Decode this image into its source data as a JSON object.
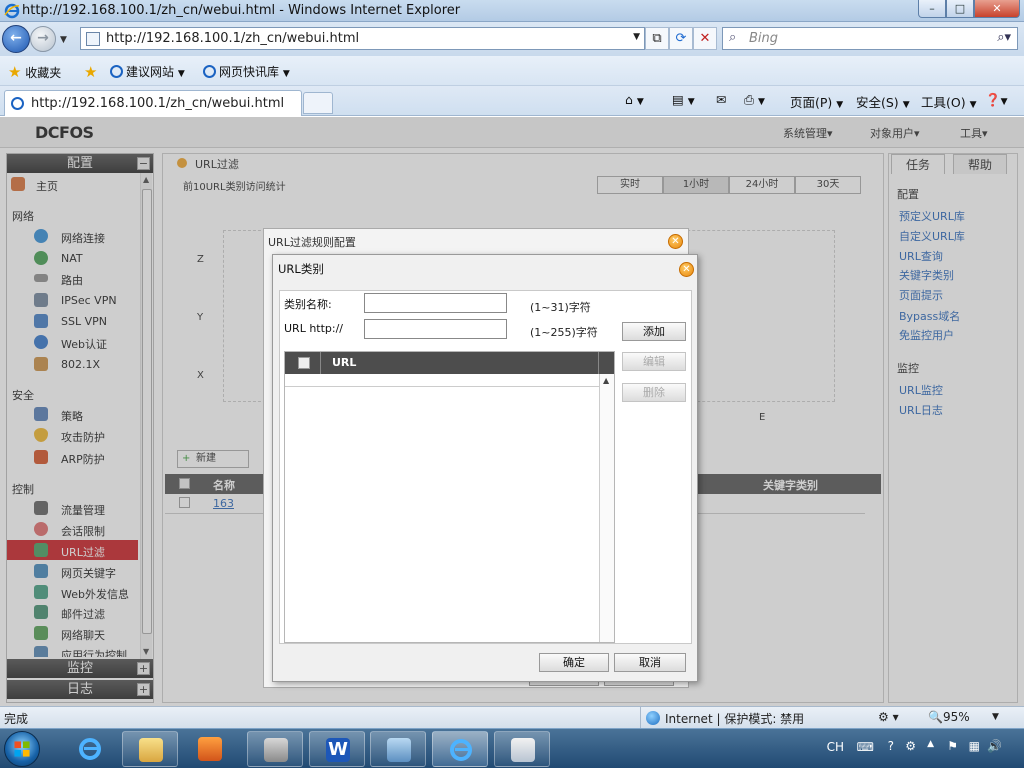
{
  "window": {
    "title": "http://192.168.100.1/zh_cn/webui.html - Windows Internet Explorer",
    "minimize": "–",
    "maximize": "□",
    "close": "✕"
  },
  "address_bar": {
    "url": "http://192.168.100.1/zh_cn/webui.html",
    "search_placeholder": "Bing"
  },
  "favorites_bar": {
    "favorites": "收藏夹",
    "suggested_sites": "建议网站",
    "web_slice_gallery": "网页快讯库"
  },
  "tab": {
    "title": "http://192.168.100.1/zh_cn/webui.html"
  },
  "command_bar": {
    "page": "页面(P)",
    "safety": "安全(S)",
    "tools": "工具(O)"
  },
  "app": {
    "brand": "DCFOS",
    "menu": [
      "系统管理",
      "对象用户",
      "工具"
    ]
  },
  "sidebar": {
    "config_header": "配置",
    "home": "主页",
    "sections": {
      "network": "网络",
      "security": "安全",
      "control": "控制"
    },
    "network_items": [
      "网络连接",
      "NAT",
      "路由",
      "IPSec VPN",
      "SSL VPN",
      "Web认证",
      "802.1X"
    ],
    "security_items": [
      "策略",
      "攻击防护",
      "ARP防护"
    ],
    "control_items": [
      "流量管理",
      "会话限制",
      "URL过滤",
      "网页关键字",
      "Web外发信息",
      "邮件过滤",
      "网络聊天",
      "应用行为控制"
    ],
    "monitor_header": "监控",
    "log_header": "日志",
    "plus": "+",
    "minus": "−"
  },
  "main": {
    "title": "URL过滤",
    "subtitle": "前10URL类别访问统计",
    "time_tabs": [
      "实时",
      "1小时",
      "24小时",
      "30天"
    ],
    "chart_axes": [
      "Z",
      "Y",
      "X",
      "E"
    ],
    "add_button": "新建",
    "table_headers": [
      "名称",
      "关键字类别"
    ],
    "table_rows": [
      "163"
    ]
  },
  "right_panel": {
    "tabs": [
      "任务",
      "帮助"
    ],
    "config_section": "配置",
    "config_links": [
      "预定义URL库",
      "自定义URL库",
      "URL查询",
      "关键字类别",
      "页面提示",
      "Bypass域名",
      "免监控用户"
    ],
    "monitor_section": "监控",
    "monitor_links": [
      "URL监控",
      "URL日志"
    ]
  },
  "dialog_rule": {
    "title": "URL过滤规则配置",
    "ok": "确定",
    "cancel": "取消"
  },
  "dialog_category": {
    "title": "URL类别",
    "name_label": "类别名称:",
    "name_hint": "(1~31)字符",
    "url_label": "URL http://",
    "url_hint": "(1~255)字符",
    "add": "添加",
    "edit": "编辑",
    "delete": "删除",
    "table_header": "URL",
    "ok": "确定",
    "cancel": "取消"
  },
  "status_bar": {
    "status": "完成",
    "zone": "Internet | 保护模式: 禁用",
    "zoom": "95%"
  },
  "taskbar": {
    "ime": "CH"
  }
}
